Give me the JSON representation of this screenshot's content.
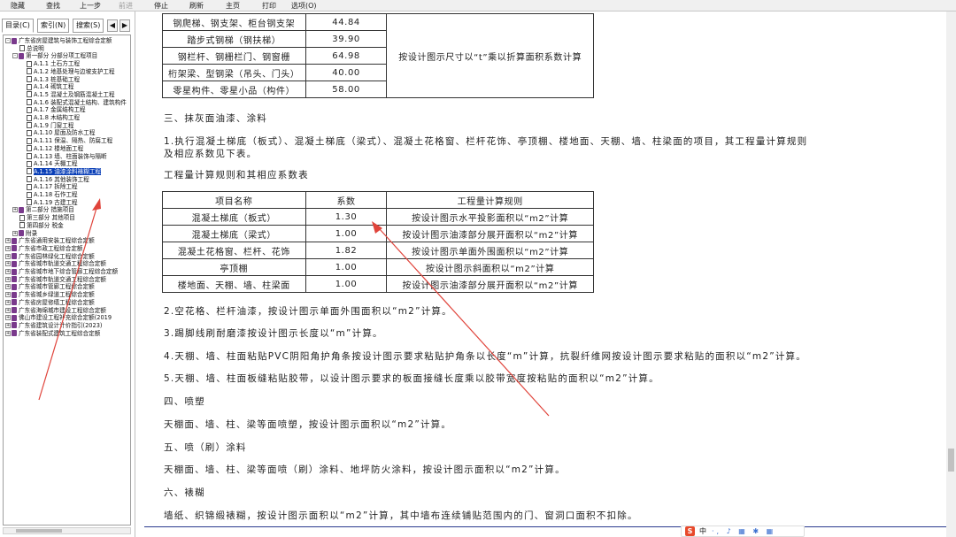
{
  "toolbar": {
    "items": [
      {
        "label": "隐藏",
        "enabled": true
      },
      {
        "label": "查找",
        "enabled": true
      },
      {
        "label": "上一步",
        "enabled": true
      },
      {
        "label": "前进",
        "enabled": false
      },
      {
        "label": "停止",
        "enabled": true
      },
      {
        "label": "刷新",
        "enabled": true
      },
      {
        "label": "主页",
        "enabled": true
      },
      {
        "label": "打印",
        "enabled": true
      },
      {
        "label": "选项(O)",
        "enabled": true
      }
    ]
  },
  "sidebar": {
    "tabs": [
      "目录(C)",
      "索引(N)",
      "搜索(S)"
    ],
    "tree": [
      {
        "label": "广东省房屋建筑与装饰工程综合定额",
        "icon": "book",
        "toggle": "-"
      },
      {
        "label": "总说明",
        "icon": "doc",
        "toggle": ""
      },
      {
        "label": "第一部分 分部分项工程项目",
        "icon": "book",
        "toggle": "-"
      },
      {
        "label": "A.1.1 土石方工程",
        "icon": "doc",
        "toggle": ""
      },
      {
        "label": "A.1.2 地基处理与边坡支护工程",
        "icon": "doc",
        "toggle": ""
      },
      {
        "label": "A.1.3 桩基础工程",
        "icon": "doc",
        "toggle": ""
      },
      {
        "label": "A.1.4 砌筑工程",
        "icon": "doc",
        "toggle": ""
      },
      {
        "label": "A.1.5 混凝土及钢筋混凝土工程",
        "icon": "doc",
        "toggle": ""
      },
      {
        "label": "A.1.6 装配式混凝土结构、建筑构件",
        "icon": "doc",
        "toggle": ""
      },
      {
        "label": "A.1.7 金属结构工程",
        "icon": "doc",
        "toggle": ""
      },
      {
        "label": "A.1.8 木结构工程",
        "icon": "doc",
        "toggle": ""
      },
      {
        "label": "A.1.9 门窗工程",
        "icon": "doc",
        "toggle": ""
      },
      {
        "label": "A.1.10 屋面及防水工程",
        "icon": "doc",
        "toggle": ""
      },
      {
        "label": "A.1.11 保温、隔热、防腐工程",
        "icon": "doc",
        "toggle": ""
      },
      {
        "label": "A.1.12 楼地面工程",
        "icon": "doc",
        "toggle": ""
      },
      {
        "label": "A.1.13 墙、柱面装饰与隔断",
        "icon": "doc",
        "toggle": ""
      },
      {
        "label": "A.1.14 天棚工程",
        "icon": "doc",
        "toggle": ""
      },
      {
        "label": "A.1.15 油漆涂料裱糊工程",
        "icon": "doc",
        "toggle": "",
        "selected": true
      },
      {
        "label": "A.1.16 其他装饰工程",
        "icon": "doc",
        "toggle": ""
      },
      {
        "label": "A.1.17 拆除工程",
        "icon": "doc",
        "toggle": ""
      },
      {
        "label": "A.1.18 石作工程",
        "icon": "doc",
        "toggle": ""
      },
      {
        "label": "A.1.19 古建工程",
        "icon": "doc",
        "toggle": ""
      },
      {
        "label": "第二部分 措施项目",
        "icon": "book",
        "toggle": "+"
      },
      {
        "label": "第三部分 其他项目",
        "icon": "doc",
        "toggle": ""
      },
      {
        "label": "第四部分 税金",
        "icon": "doc",
        "toggle": ""
      },
      {
        "label": "附录",
        "icon": "book",
        "toggle": "+"
      },
      {
        "label": "广东省通用安装工程综合定额",
        "icon": "book",
        "toggle": "+"
      },
      {
        "label": "广东省市政工程综合定额",
        "icon": "book",
        "toggle": "+"
      },
      {
        "label": "广东省园林绿化工程综合定额",
        "icon": "book",
        "toggle": "+"
      },
      {
        "label": "广东省城市轨道交通工程综合定额",
        "icon": "book",
        "toggle": "+"
      },
      {
        "label": "广东省城市地下综合管廊工程综合定额",
        "icon": "book",
        "toggle": "+"
      },
      {
        "label": "广东省城市轨道交通工程综合定额",
        "icon": "book",
        "toggle": "+"
      },
      {
        "label": "广东省城市管廊工程综合定额",
        "icon": "book",
        "toggle": "+"
      },
      {
        "label": "广东省城乡绿道工程综合定额",
        "icon": "book",
        "toggle": "+"
      },
      {
        "label": "广东省房屋修缮工程综合定额",
        "icon": "book",
        "toggle": "+"
      },
      {
        "label": "广东省海绵城市建设工程综合定额",
        "icon": "book",
        "toggle": "+"
      },
      {
        "label": "佛山市建设工程补充综合定额(2019",
        "icon": "book",
        "toggle": "+"
      },
      {
        "label": "广东省建筑设计计价指引(2023)",
        "icon": "book",
        "toggle": "+"
      },
      {
        "label": "广东省装配式建筑工程综合定额",
        "icon": "book",
        "toggle": "+"
      }
    ]
  },
  "table1": {
    "rows": [
      {
        "name": "钢爬梯、钢支架、柜台钢支架",
        "coef": "44.84"
      },
      {
        "name": "踏步式钢梯（钢扶梯）",
        "coef": "39.90"
      },
      {
        "name": "钢栏杆、钢栅栏门、钢窗栅",
        "coef": "64.98"
      },
      {
        "name": "桁架梁、型钢梁（吊头、门头）",
        "coef": "40.00"
      },
      {
        "name": "零星构件、零星小品（构件）",
        "coef": "58.00"
      }
    ],
    "rule": "按设计图示尺寸以“t”乘以折算面积系数计算"
  },
  "section3": {
    "heading": "三、抹灰面油漆、涂料",
    "para1_line1": "1.执行混凝土梯底（板式）、混凝土梯底（梁式）、混凝土花格窗、栏杆花饰、亭顶棚、楼地面、天棚、墙、柱梁面的项目，其工程量计算规则",
    "para1_line2": "及相应系数见下表。",
    "table_title": "工程量计算规则和其相应系数表"
  },
  "table2": {
    "headers": [
      "项目名称",
      "系数",
      "工程量计算规则"
    ],
    "rows": [
      {
        "name": "混凝土梯底（板式）",
        "coef": "1.30",
        "rule": "按设计图示水平投影面积以“m2”计算"
      },
      {
        "name": "混凝土梯底（梁式）",
        "coef": "1.00",
        "rule": "按设计图示油漆部分展开面积以“m2”计算"
      },
      {
        "name": "混凝土花格窗、栏杆、花饰",
        "coef": "1.82",
        "rule": "按设计图示单面外围面积以“m2”计算"
      },
      {
        "name": "亭顶棚",
        "coef": "1.00",
        "rule": "按设计图示斜面积以“m2”计算"
      },
      {
        "name": "楼地面、天棚、墙、柱梁面",
        "coef": "1.00",
        "rule": "按设计图示油漆部分展开面积以“m2”计算"
      }
    ]
  },
  "paragraphs": [
    "2.空花格、栏杆油漆，按设计图示单面外围面积以“m2”计算。",
    "3.踢脚线刷耐磨漆按设计图示长度以“m”计算。",
    "4.天棚、墙、柱面粘贴PVC阴阳角护角条按设计图示要求粘贴护角条以长度“m”计算，抗裂纤维网按设计图示要求粘贴的面积以“m2”计算。",
    "5.天棚、墙、柱面板缝粘贴胶带，以设计图示要求的板面接缝长度乘以胶带宽度按粘贴的面积以“m2”计算。",
    "四、喷塑",
    "天棚面、墙、柱、梁等面喷塑，按设计图示面积以“m2”计算。",
    "五、喷（刷）涂料",
    "天棚面、墙、柱、梁等面喷（刷）涂料、地坪防火涂料，按设计图示面积以“m2”计算。",
    "六、裱糊",
    "墙纸、织锦缎裱糊，按设计图示面积以“m2”计算，其中墙布连续铺贴范围内的门、窗洞口面积不扣除。"
  ],
  "ime": {
    "logo": "S",
    "mode": "中",
    "items": "·, ♪ ▦ ✱ ▦"
  },
  "colors": {
    "selected": "#0a3fb7",
    "annotation": "#e0443b",
    "book_icon": "#7a3a8c"
  }
}
